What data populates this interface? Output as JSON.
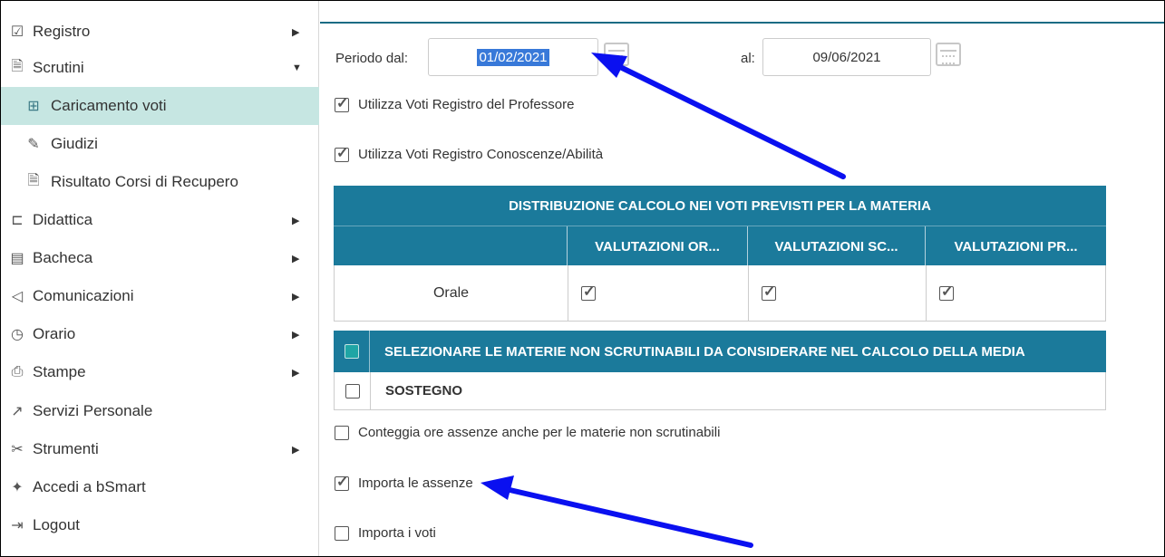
{
  "sidebar": {
    "items": [
      {
        "label": "Registro",
        "icon": "calendar-check-icon",
        "glyph": "☑",
        "arrow": "▶"
      },
      {
        "label": "Scrutini",
        "icon": "document-icon",
        "glyph": "🗎",
        "arrow": "▼"
      },
      {
        "label": "Caricamento voti",
        "icon": "grid-icon",
        "glyph": "⊞"
      },
      {
        "label": "Giudizi",
        "icon": "edit-icon",
        "glyph": "✎"
      },
      {
        "label": "Risultato Corsi di Recupero",
        "icon": "document-icon",
        "glyph": "🗎"
      },
      {
        "label": "Didattica",
        "icon": "book-icon",
        "glyph": "⊏",
        "arrow": "▶"
      },
      {
        "label": "Bacheca",
        "icon": "board-icon",
        "glyph": "▤",
        "arrow": "▶"
      },
      {
        "label": "Comunicazioni",
        "icon": "megaphone-icon",
        "glyph": "◁",
        "arrow": "▶"
      },
      {
        "label": "Orario",
        "icon": "clock-icon",
        "glyph": "◷",
        "arrow": "▶"
      },
      {
        "label": "Stampe",
        "icon": "printer-icon",
        "glyph": "⎙",
        "arrow": "▶"
      },
      {
        "label": "Servizi Personale",
        "icon": "share-icon",
        "glyph": "↗"
      },
      {
        "label": "Strumenti",
        "icon": "tools-icon",
        "glyph": "✂",
        "arrow": "▶"
      },
      {
        "label": "Accedi a bSmart",
        "icon": "bsmart-icon",
        "glyph": "✦"
      },
      {
        "label": "Logout",
        "icon": "logout-icon",
        "glyph": "⇥"
      }
    ]
  },
  "period": {
    "from_label": "Periodo dal:",
    "from_value": "01/02/2021",
    "to_label": "al:",
    "to_value": "09/06/2021"
  },
  "options": {
    "use_prof_register": "Utilizza Voti Registro del Professore",
    "use_skills_register": "Utilizza Voti Registro Conoscenze/Abilità"
  },
  "distribution_table": {
    "title": "DISTRIBUZIONE CALCOLO NEI VOTI PREVISTI PER LA MATERIA",
    "columns": [
      "VALUTAZIONI OR...",
      "VALUTAZIONI SC...",
      "VALUTAZIONI PR..."
    ],
    "row_label": "Orale",
    "row_values": [
      true,
      true,
      true
    ]
  },
  "subjects_table": {
    "header": "SELEZIONARE LE MATERIE NON SCRUTINABILI DA CONSIDERARE NEL CALCOLO DELLA MEDIA",
    "rows": [
      "SOSTEGNO"
    ]
  },
  "bottom_options": {
    "count_absences": "Conteggia ore assenze anche per le materie non scrutinabili",
    "import_absences": "Importa le assenze",
    "import_votes": "Importa i voti"
  },
  "colors": {
    "header_teal": "#1b7a9b",
    "active_item": "#c6e6e2",
    "arrow_blue": "#0a10f0",
    "selection_blue": "#3879d9"
  }
}
